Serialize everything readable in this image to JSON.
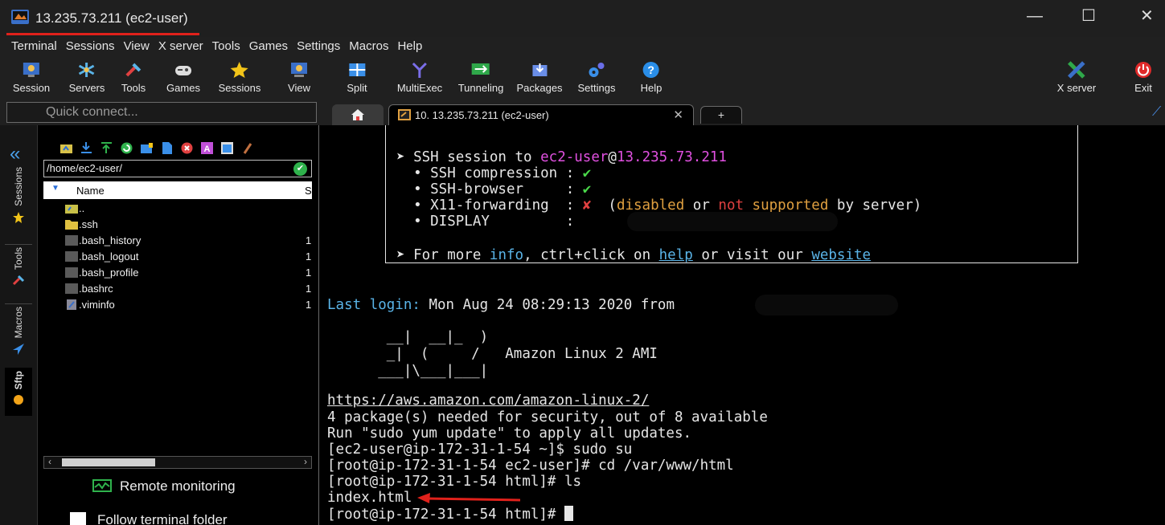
{
  "window": {
    "title": "13.235.73.211 (ec2-user)",
    "minimize": "—",
    "maximize": "☐",
    "close": "✕"
  },
  "menu": [
    "Terminal",
    "Sessions",
    "View",
    "X server",
    "Tools",
    "Games",
    "Settings",
    "Macros",
    "Help"
  ],
  "toolbar": {
    "session": "Session",
    "servers": "Servers",
    "tools": "Tools",
    "games": "Games",
    "sessions": "Sessions",
    "view": "View",
    "split": "Split",
    "multiexec": "MultiExec",
    "tunneling": "Tunneling",
    "packages": "Packages",
    "settings": "Settings",
    "help": "Help",
    "xserver": "X server",
    "exit": "Exit"
  },
  "quick_connect": {
    "placeholder": "Quick connect..."
  },
  "tabs": {
    "session_label": "10. 13.235.73.211 (ec2-user)",
    "close": "✕",
    "new": "+"
  },
  "side_tabs": {
    "sessions": "Sessions",
    "tools": "Tools",
    "macros": "Macros",
    "sftp": "Sftp"
  },
  "browser": {
    "path": "/home/ec2-user/",
    "col_name": "Name",
    "col_size": "S",
    "files": [
      {
        "name": "..",
        "size": ""
      },
      {
        "name": ".ssh",
        "size": ""
      },
      {
        "name": ".bash_history",
        "size": "1"
      },
      {
        "name": ".bash_logout",
        "size": "1"
      },
      {
        "name": ".bash_profile",
        "size": "1"
      },
      {
        "name": ".bashrc",
        "size": "1"
      },
      {
        "name": ".viminfo",
        "size": "1"
      }
    ],
    "remote_monitoring": "Remote monitoring",
    "follow_folder": "Follow terminal folder"
  },
  "terminal": {
    "ssh_prefix": "➤ SSH session to ",
    "ssh_user": "ec2-user",
    "ssh_at": "@",
    "ssh_host": "13.235.73.211",
    "compression_label": "  • SSH compression : ",
    "browser_label": "  • SSH-browser     : ",
    "check": "✔",
    "x11_label": "  • X11-forwarding  : ",
    "cross": "✘",
    "x11_open": "  (",
    "x11_disabled": "disabled",
    "x11_or": " or ",
    "x11_not": "not",
    "x11_supported": " supported",
    "x11_by": " by server)",
    "display_label": "  • DISPLAY         : ",
    "info_prefix": "➤ For more ",
    "info_word": "info",
    "info_mid": ", ctrl+click on ",
    "help_word": "help",
    "info_or": " or visit our ",
    "website_word": "website",
    "last_login_label": "Last login:",
    "last_login_value": " Mon Aug 24 08:29:13 2020 from ",
    "art1": "       __|  __|_  )",
    "art2": "       _|  (     /   Amazon Linux 2 AMI",
    "art3": "      ___|\\___|___|",
    "url": "https://aws.amazon.com/amazon-linux-2/",
    "l_packages": "4 package(s) needed for security, out of 8 available",
    "l_run": "Run \"sudo yum update\" to apply all updates.",
    "l_sudo": "[ec2-user@ip-172-31-1-54 ~]$ sudo su",
    "l_cd": "[root@ip-172-31-1-54 ec2-user]# cd /var/www/html",
    "l_ls": "[root@ip-172-31-1-54 html]# ls",
    "l_index": "index.html",
    "l_prompt": "[root@ip-172-31-1-54 html]# "
  }
}
